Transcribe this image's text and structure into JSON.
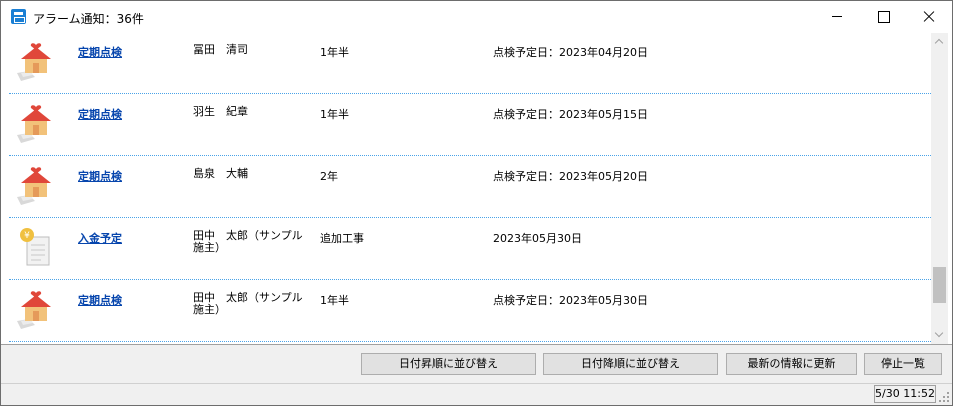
{
  "window": {
    "title": "アラーム通知：36件"
  },
  "rows": [
    {
      "type_label": "定期点検",
      "icon": "house-heart-icon",
      "name": "冨田　清司",
      "detail": "1年半",
      "date": "点検予定日：2023年04月20日"
    },
    {
      "type_label": "定期点検",
      "icon": "house-heart-icon",
      "name": "羽生　紀章",
      "detail": "1年半",
      "date": "点検予定日：2023年05月15日"
    },
    {
      "type_label": "定期点検",
      "icon": "house-heart-icon",
      "name": "島泉　大輔",
      "detail": "2年",
      "date": "点検予定日：2023年05月20日"
    },
    {
      "type_label": "入金予定",
      "icon": "yen-document-icon",
      "name": "田中　太郎（サンプル施主）",
      "detail": "追加工事",
      "date": "2023年05月30日"
    },
    {
      "type_label": "定期点検",
      "icon": "house-heart-icon",
      "name": "田中　太郎（サンプル施主）",
      "detail": "1年半",
      "date": "点検予定日：2023年05月30日"
    }
  ],
  "buttons": {
    "sort_asc": "日付昇順に並び替え",
    "sort_desc": "日付降順に並び替え",
    "refresh": "最新の情報に更新",
    "stop": "停止一覧"
  },
  "status": {
    "time": "5/30 11:52"
  },
  "scroll": {
    "position": 0.9,
    "visible_fraction": 0.13
  },
  "colors": {
    "link": "#0645ad",
    "divider": "#4aa3e8",
    "house_roof": "#e0473a",
    "house_body": "#f2c27a",
    "heart": "#e0473a",
    "coin": "#f0c040"
  }
}
